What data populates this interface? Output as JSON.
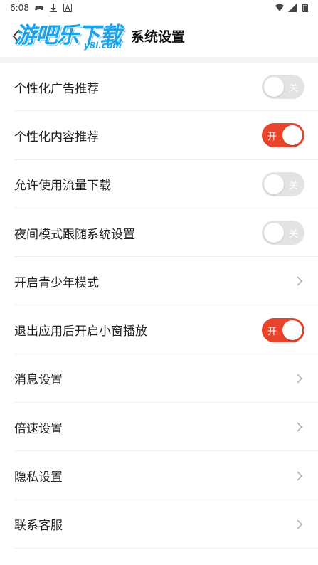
{
  "status_bar": {
    "time": "6:08",
    "left_icons": [
      "game-controller-icon",
      "download-icon",
      "font-icon"
    ],
    "right_icons": [
      "wifi-icon",
      "signal-icon",
      "battery-icon"
    ]
  },
  "header": {
    "logo_text": "游吧乐下载",
    "logo_domain": "y8l.com",
    "title": "系统设置",
    "back_icon": "back-chevron-icon"
  },
  "colors": {
    "accent": "#e8432b",
    "toggle_off": "#e3e3e3",
    "logo_blue": "#1aa3e8"
  },
  "settings": {
    "items": [
      {
        "label": "个性化广告推荐",
        "control": "toggle",
        "state": "关"
      },
      {
        "label": "个性化内容推荐",
        "control": "toggle",
        "state": "开"
      },
      {
        "label": "允许使用流量下载",
        "control": "toggle",
        "state": "关"
      },
      {
        "label": "夜间模式跟随系统设置",
        "control": "toggle",
        "state": "关"
      },
      {
        "label": "开启青少年模式",
        "control": "chevron"
      },
      {
        "label": "退出应用后开启小窗播放",
        "control": "toggle",
        "state": "开"
      },
      {
        "label": "消息设置",
        "control": "chevron"
      },
      {
        "label": "倍速设置",
        "control": "chevron"
      },
      {
        "label": "隐私设置",
        "control": "chevron"
      },
      {
        "label": "联系客服",
        "control": "chevron"
      }
    ]
  }
}
